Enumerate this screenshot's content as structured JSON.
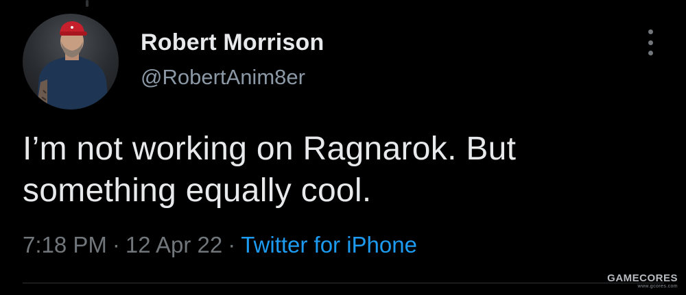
{
  "tweet": {
    "author": {
      "display_name": "Robert Morrison",
      "handle": "@RobertAnim8er",
      "avatar_icon": "profile-photo-avatar"
    },
    "more_icon": "more-vertical-icon",
    "text": "I’m not working on Ragnarok. But something equally cool.",
    "time": "7:18 PM",
    "separator": "·",
    "date": "12 Apr 22",
    "source": "Twitter for iPhone"
  },
  "watermark": {
    "brand": "GAMECORES",
    "url": "www.gcores.com"
  },
  "colors": {
    "background": "#000000",
    "text_primary": "#e7e9ea",
    "text_secondary": "#71767b",
    "link": "#1d9bf0",
    "divider": "#2f3336"
  }
}
